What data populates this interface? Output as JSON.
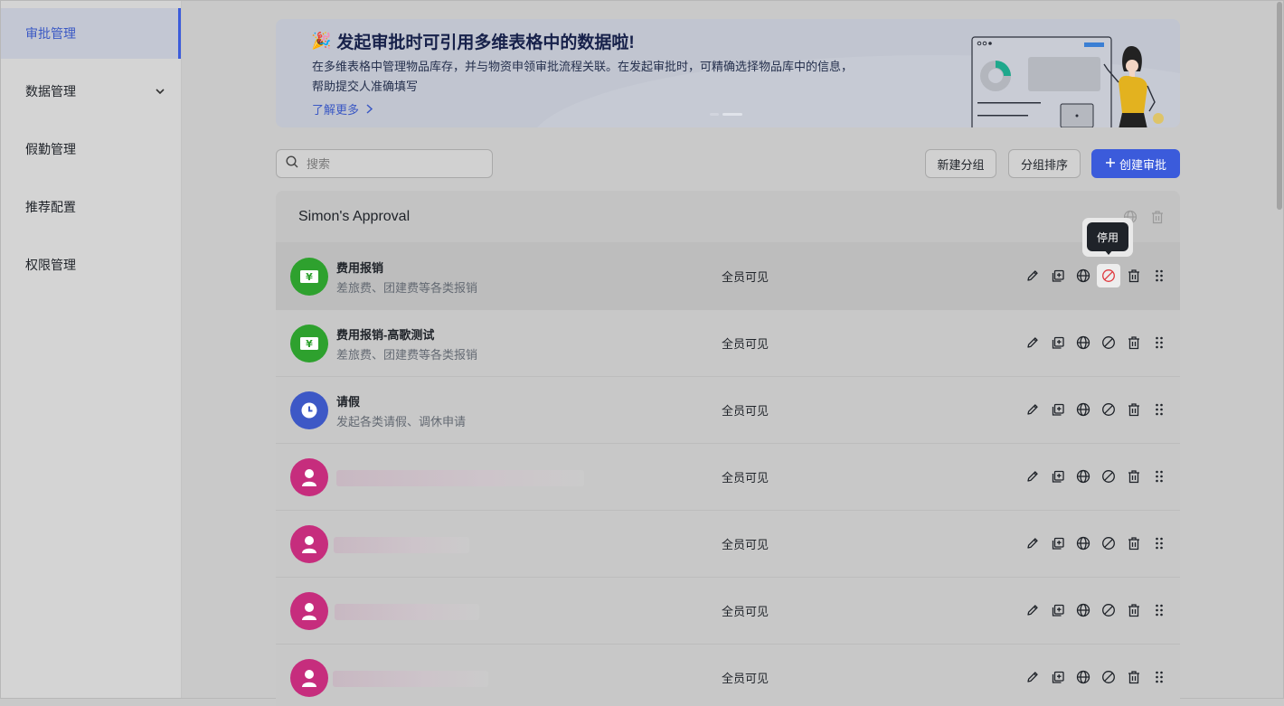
{
  "sidebar": {
    "items": [
      {
        "label": "审批管理",
        "active": true
      },
      {
        "label": "数据管理",
        "has_chevron": true
      },
      {
        "label": "假勤管理"
      },
      {
        "label": "推荐配置"
      },
      {
        "label": "权限管理"
      }
    ]
  },
  "banner": {
    "title": "发起审批时可引用多维表格中的数据啦!",
    "desc_line1": "在多维表格中管理物品库存，并与物资申领审批流程关联。在发起审批时，可精确选择物品库中的信息，",
    "desc_line2": "帮助提交人准确填写",
    "link": "了解更多"
  },
  "toolbar": {
    "search_placeholder": "搜索",
    "new_group": "新建分组",
    "sort_groups": "分组排序",
    "create_approval": "创建审批"
  },
  "group": {
    "title": "Simon's Approval",
    "rows": [
      {
        "title": "费用报销",
        "subtitle": "差旅费、团建费等各类报销",
        "visibility": "全员可见",
        "icon": "yen-icon",
        "color": "#2ea12e"
      },
      {
        "title": "费用报销-高歌测试",
        "subtitle": "差旅费、团建费等各类报销",
        "visibility": "全员可见",
        "icon": "yen-icon",
        "color": "#2ea12e"
      },
      {
        "title": "请假",
        "subtitle": "发起各类请假、调休申请",
        "visibility": "全员可见",
        "icon": "clock-icon",
        "color": "#3d58c6"
      },
      {
        "title": "",
        "subtitle": "",
        "visibility": "全员可见",
        "icon": "person-icon",
        "color": "#c62d7d"
      },
      {
        "title": "",
        "subtitle": "",
        "visibility": "全员可见",
        "icon": "person-icon",
        "color": "#c62d7d"
      },
      {
        "title": "",
        "subtitle": "",
        "visibility": "全员可见",
        "icon": "person-icon",
        "color": "#c62d7d"
      },
      {
        "title": "",
        "subtitle": "",
        "visibility": "全员可见",
        "icon": "person-icon",
        "color": "#c62d7d"
      }
    ]
  },
  "tooltip": {
    "label": "停用"
  },
  "colors": {
    "accent": "#3b5bdb",
    "disable_red": "#e0393e"
  }
}
